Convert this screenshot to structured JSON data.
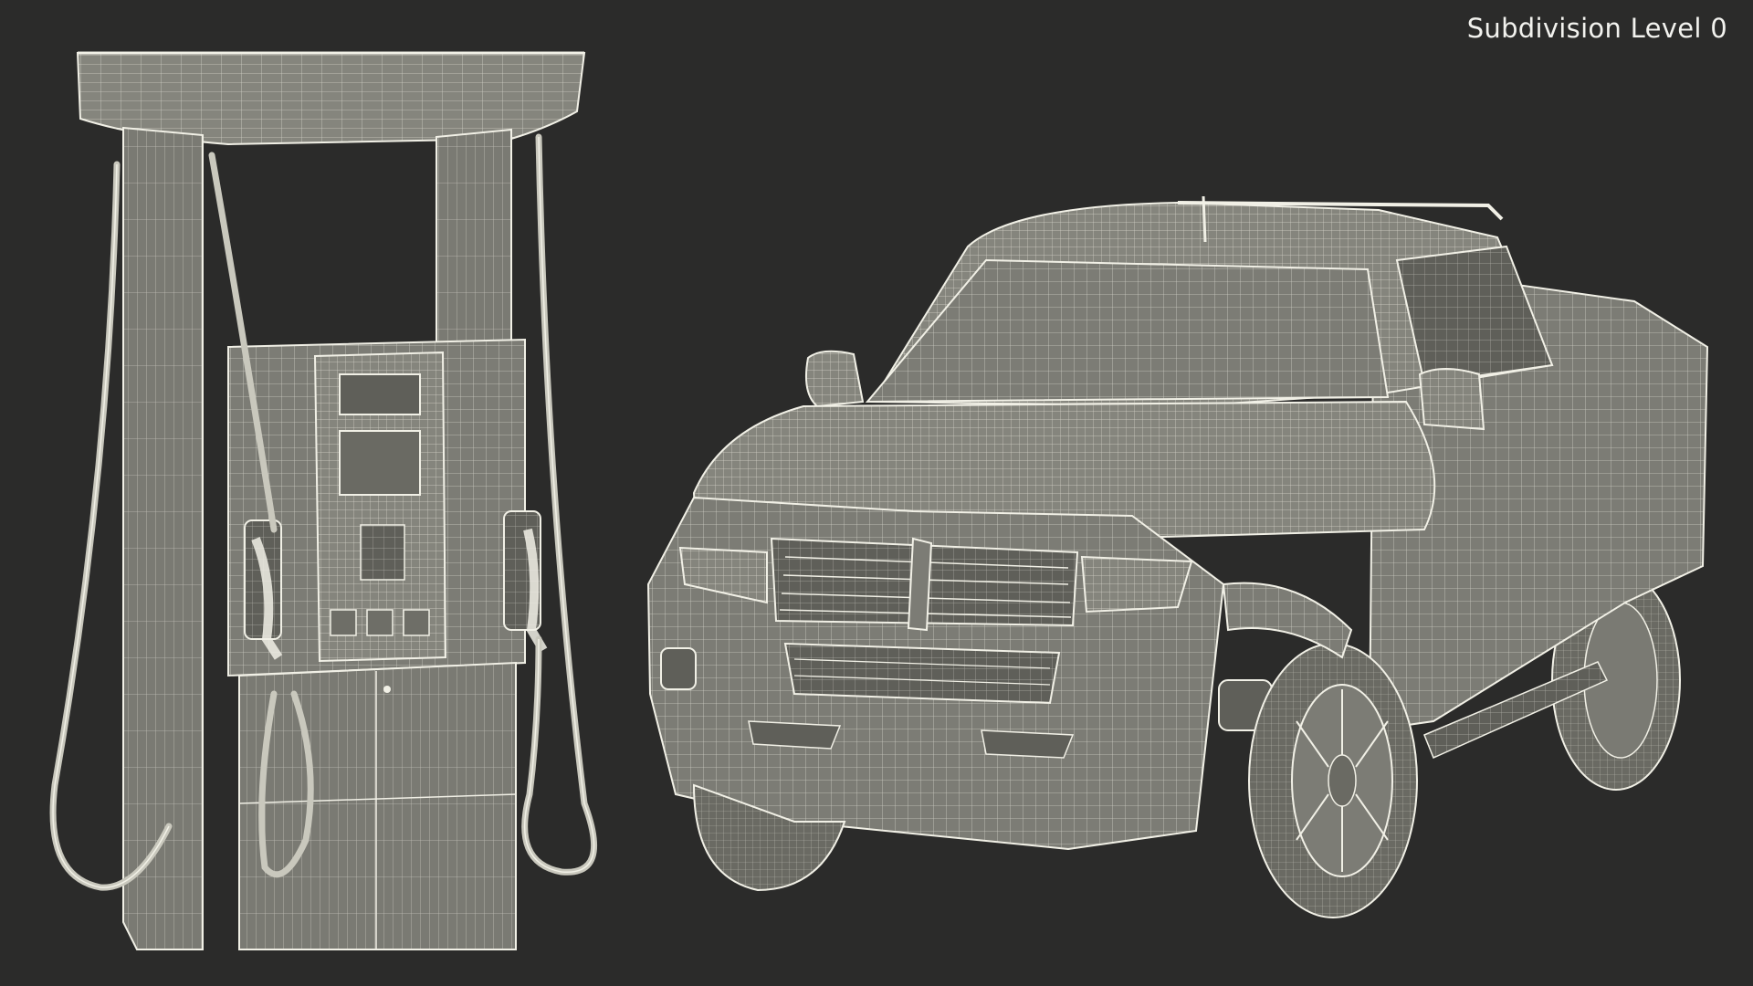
{
  "overlay": {
    "subdivision_label": "Subdivision Level 0"
  },
  "colors": {
    "background": "#2b2b2a",
    "mesh_fill": "#85857d",
    "mesh_fill_dark": "#6e6e67",
    "wire": "#f1f0e6",
    "label_text": "#f2f2ee"
  },
  "scene": {
    "objects": [
      {
        "id": "fuel-dispenser"
      },
      {
        "id": "pickup-truck"
      }
    ]
  }
}
